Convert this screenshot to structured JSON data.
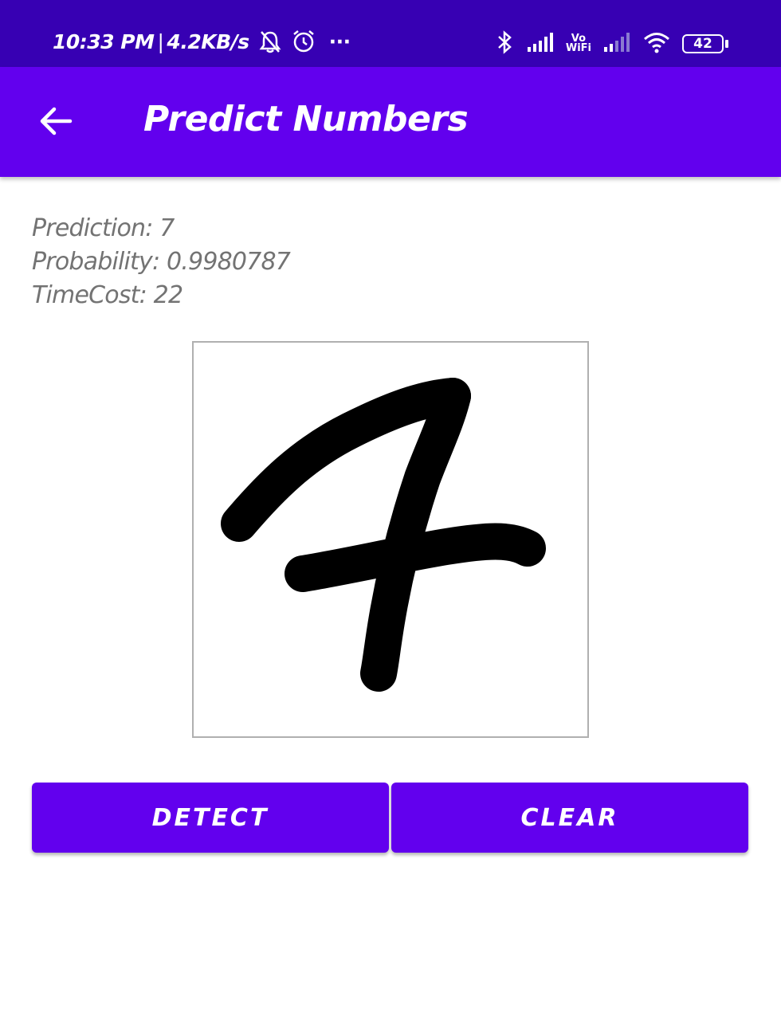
{
  "status_bar": {
    "time": "10:33 PM",
    "separator": "|",
    "net_speed": "4.2KB/s",
    "more": "···",
    "battery": "42",
    "icons": [
      "bell-off-icon",
      "alarm-icon",
      "more-icon",
      "bluetooth-icon",
      "signal-icon",
      "vowifi-icon",
      "signal-icon",
      "wifi-icon",
      "battery-icon"
    ],
    "vowifi_top": "Vo",
    "vowifi_bottom": "WiFi"
  },
  "app_bar": {
    "title": "Predict Numbers",
    "background": "#6200ee",
    "icon": "back-arrow-icon"
  },
  "result": {
    "prediction": "Prediction: 7",
    "probability": "Probability: 0.9980787",
    "time_cost": "TimeCost: 22"
  },
  "canvas": {
    "drawn_digit": "7"
  },
  "buttons": {
    "detect": "DETECT",
    "clear": "CLEAR"
  },
  "colors": {
    "status_bar": "#3700b3",
    "accent": "#6200ee",
    "result_text": "#737373"
  }
}
